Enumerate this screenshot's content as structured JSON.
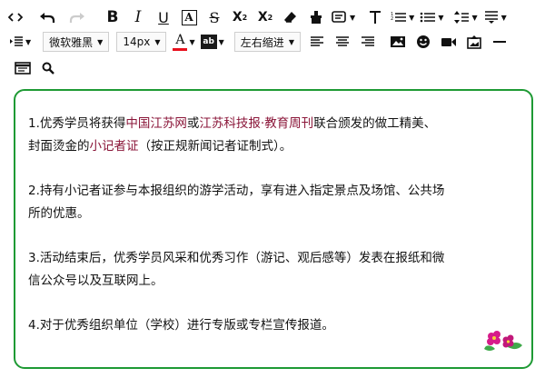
{
  "toolbar": {
    "font_family": "微软雅黑",
    "font_size": "14px",
    "font_color_label": "A",
    "font_color": "#e8101d",
    "bg_color_label": "ab",
    "indent_label": "左右缩进"
  },
  "editor": {
    "border_color": "#1e9a34",
    "paragraphs": [
      {
        "p1a": "1.优秀学员将获得",
        "p1b": "中国江苏网",
        "p1c": "或",
        "p1d": "江苏科技报",
        "p1e": "·",
        "p1f": "教育周刊",
        "p1g": "联合颁发的做工精美、",
        "p1h": "封面烫金的",
        "p1i": "小记者证",
        "p1j": "（按正规新闻记者证制式）。"
      }
    ],
    "p2": "2.持有小记者证参与本报组织的游学活动，享有进入指定景点及场馆、公共场所的优惠。",
    "p2a": "2.持有小记者证参与本报组织的游学活动，享有进入指定景点及场馆、公共场",
    "p2b": "所的优惠。",
    "p3a": "3.活动结束后，优秀学员风采和优秀习作（游记、观后感等）发表在报纸和微",
    "p3b": "信公众号以及互联网上。",
    "p4": "4.对于优秀组织单位（学校）进行专版或专栏宣传报道。",
    "highlight_color": "#8a1538"
  }
}
